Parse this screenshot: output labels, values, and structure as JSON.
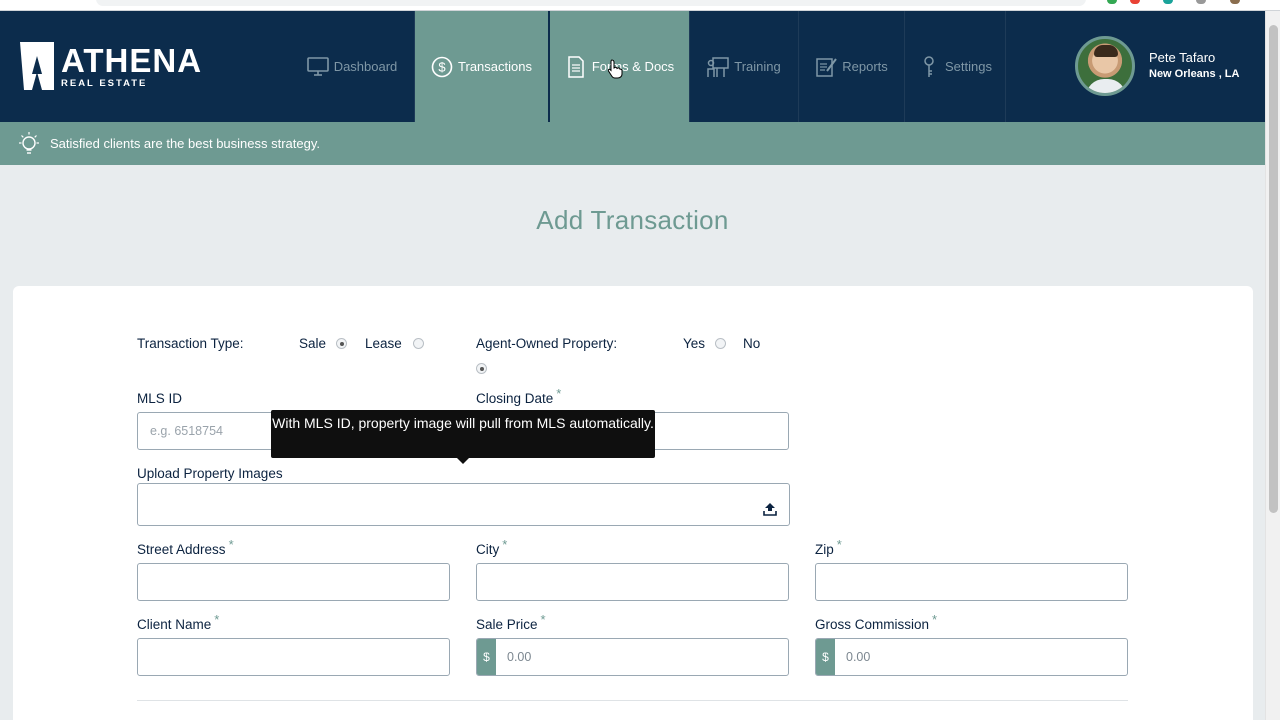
{
  "header": {
    "brand": "ATHENA",
    "brand_sub": "REAL ESTATE",
    "nav": [
      {
        "label": "Dashboard",
        "icon": "monitor-icon"
      },
      {
        "label": "Transactions",
        "icon": "dollar-circle-icon",
        "active": true
      },
      {
        "label": "Forms & Docs",
        "icon": "document-icon",
        "hover": true
      },
      {
        "label": "Training",
        "icon": "training-icon"
      },
      {
        "label": "Reports",
        "icon": "report-icon"
      },
      {
        "label": "Settings",
        "icon": "key-icon"
      }
    ],
    "user": {
      "name": "Pete Tafaro",
      "location": "New Orleans , LA"
    }
  },
  "tip": {
    "text": "Satisfied clients are the best business strategy.",
    "icon": "lightbulb-icon"
  },
  "page": {
    "title": "Add Transaction"
  },
  "form": {
    "transaction_type": {
      "label": "Transaction Type:",
      "options": [
        "Sale",
        "Lease"
      ],
      "selected": "Sale"
    },
    "agent_owned": {
      "label": "Agent-Owned Property:",
      "options": [
        "Yes",
        "No"
      ],
      "selected": "No"
    },
    "mls_id": {
      "label": "MLS ID",
      "placeholder": "e.g. 6518754",
      "value": ""
    },
    "closing_date": {
      "label": "Closing Date",
      "required": "*",
      "value": ""
    },
    "upload": {
      "label": "Upload Property Images",
      "icon": "upload-icon"
    },
    "street": {
      "label": "Street Address",
      "required": "*",
      "value": ""
    },
    "city": {
      "label": "City",
      "required": "*",
      "value": ""
    },
    "zip": {
      "label": "Zip",
      "required": "*",
      "value": ""
    },
    "client_name": {
      "label": "Client Name",
      "required": "*",
      "value": ""
    },
    "sale_price": {
      "label": "Sale Price",
      "required": "*",
      "currency": "$",
      "value": "0.00"
    },
    "gross_commission": {
      "label": "Gross Commission",
      "required": "*",
      "currency": "$",
      "value": "0.00"
    }
  },
  "tooltip": {
    "text": "With MLS ID, property image will pull from MLS automatically."
  },
  "colors": {
    "navy": "#0c2c4c",
    "sage": "#6e9a92",
    "background": "#e8ecee"
  }
}
